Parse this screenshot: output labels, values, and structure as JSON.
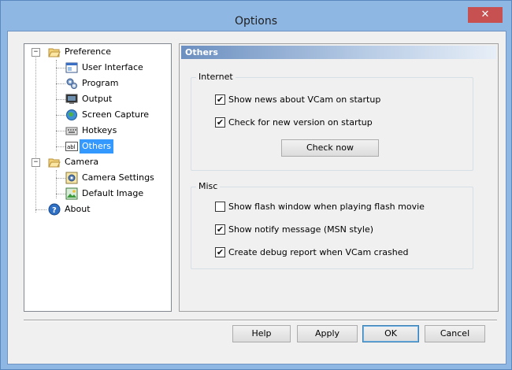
{
  "window": {
    "title": "Options",
    "close_glyph": "✕"
  },
  "tree": {
    "preference": "Preference",
    "user_interface": "User Interface",
    "program": "Program",
    "output": "Output",
    "screen_capture": "Screen Capture",
    "hotkeys": "Hotkeys",
    "others": "Others",
    "camera": "Camera",
    "camera_settings": "Camera Settings",
    "default_image": "Default Image",
    "about": "About",
    "collapse_glyph": "−",
    "abl_text": "abl"
  },
  "panel": {
    "header": "Others",
    "internet": {
      "title": "Internet",
      "show_news": "Show news about VCam on startup",
      "show_news_checked": true,
      "check_version": "Check for new version on startup",
      "check_version_checked": true,
      "check_now": "Check now"
    },
    "misc": {
      "title": "Misc",
      "flash_window": "Show flash window when playing flash movie",
      "flash_window_checked": false,
      "notify": "Show notify message (MSN style)",
      "notify_checked": true,
      "debug": "Create debug report when VCam crashed",
      "debug_checked": true
    }
  },
  "buttons": {
    "help": "Help",
    "apply": "Apply",
    "ok": "OK",
    "cancel": "Cancel"
  },
  "check_glyph": "✔",
  "colors": {
    "selection": "#3399ff",
    "close": "#c75050",
    "frame": "#8fb7e3"
  }
}
